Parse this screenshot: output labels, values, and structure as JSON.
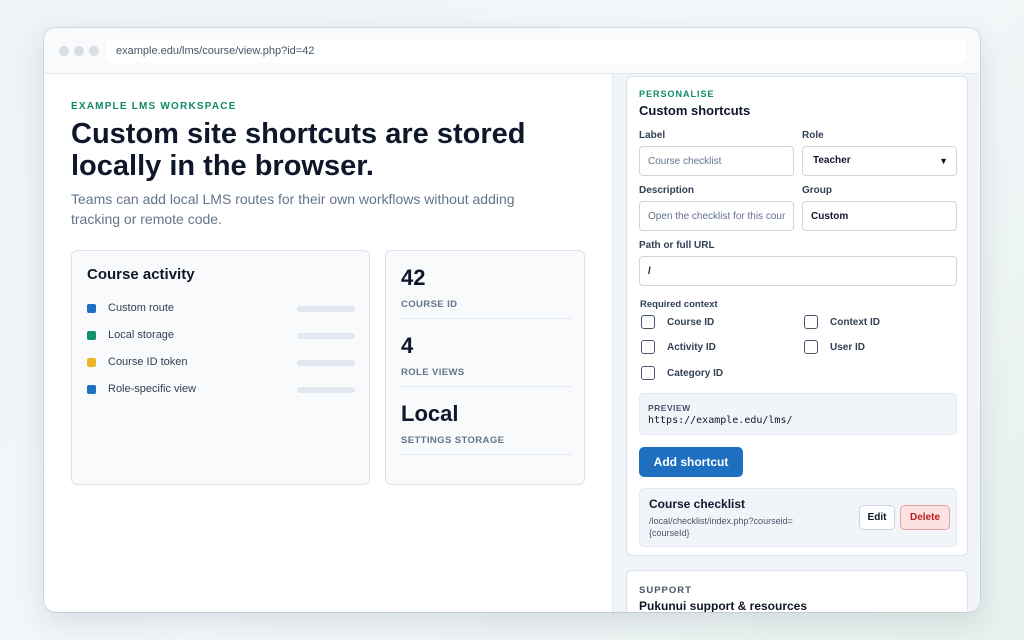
{
  "browser": {
    "url": "example.edu/lms/course/view.php?id=42"
  },
  "hero": {
    "eyebrow": "EXAMPLE LMS WORKSPACE",
    "headline": "Custom site shortcuts are stored locally in the browser.",
    "subtitle": "Teams can add local LMS routes for their own workflows without adding tracking or remote code."
  },
  "activity": {
    "title": "Course activity",
    "items": [
      {
        "label": "Custom route",
        "color": "#1f6fc0"
      },
      {
        "label": "Local storage",
        "color": "#10936b"
      },
      {
        "label": "Course ID token",
        "color": "#f0b429"
      },
      {
        "label": "Role-specific view",
        "color": "#1f6fc0"
      }
    ]
  },
  "stats": [
    {
      "value": "42",
      "caption": "COURSE ID"
    },
    {
      "value": "4",
      "caption": "ROLE VIEWS"
    },
    {
      "value": "Local",
      "caption": "SETTINGS STORAGE"
    }
  ],
  "shortcuts_form": {
    "eyebrow": "PERSONALISE",
    "title": "Custom shortcuts",
    "label_label": "Label",
    "label_placeholder": "Course checklist",
    "role_label": "Role",
    "role_value": "Teacher",
    "description_label": "Description",
    "description_placeholder": "Open the checklist for this course",
    "group_label": "Group",
    "group_value": "Custom",
    "path_label": "Path or full URL",
    "path_value": "/",
    "context_title": "Required context",
    "context_options": [
      "Course ID",
      "Context ID",
      "Activity ID",
      "User ID",
      "Category ID"
    ],
    "preview_label": "PREVIEW",
    "preview_value": "https://example.edu/lms/",
    "add_button": "Add shortcut"
  },
  "saved_shortcut": {
    "title": "Course checklist",
    "path": "/local/checklist/index.php?courseid={courseId}",
    "edit_label": "Edit",
    "delete_label": "Delete"
  },
  "support": {
    "eyebrow": "SUPPORT",
    "title": "Pukunui support & resources"
  }
}
